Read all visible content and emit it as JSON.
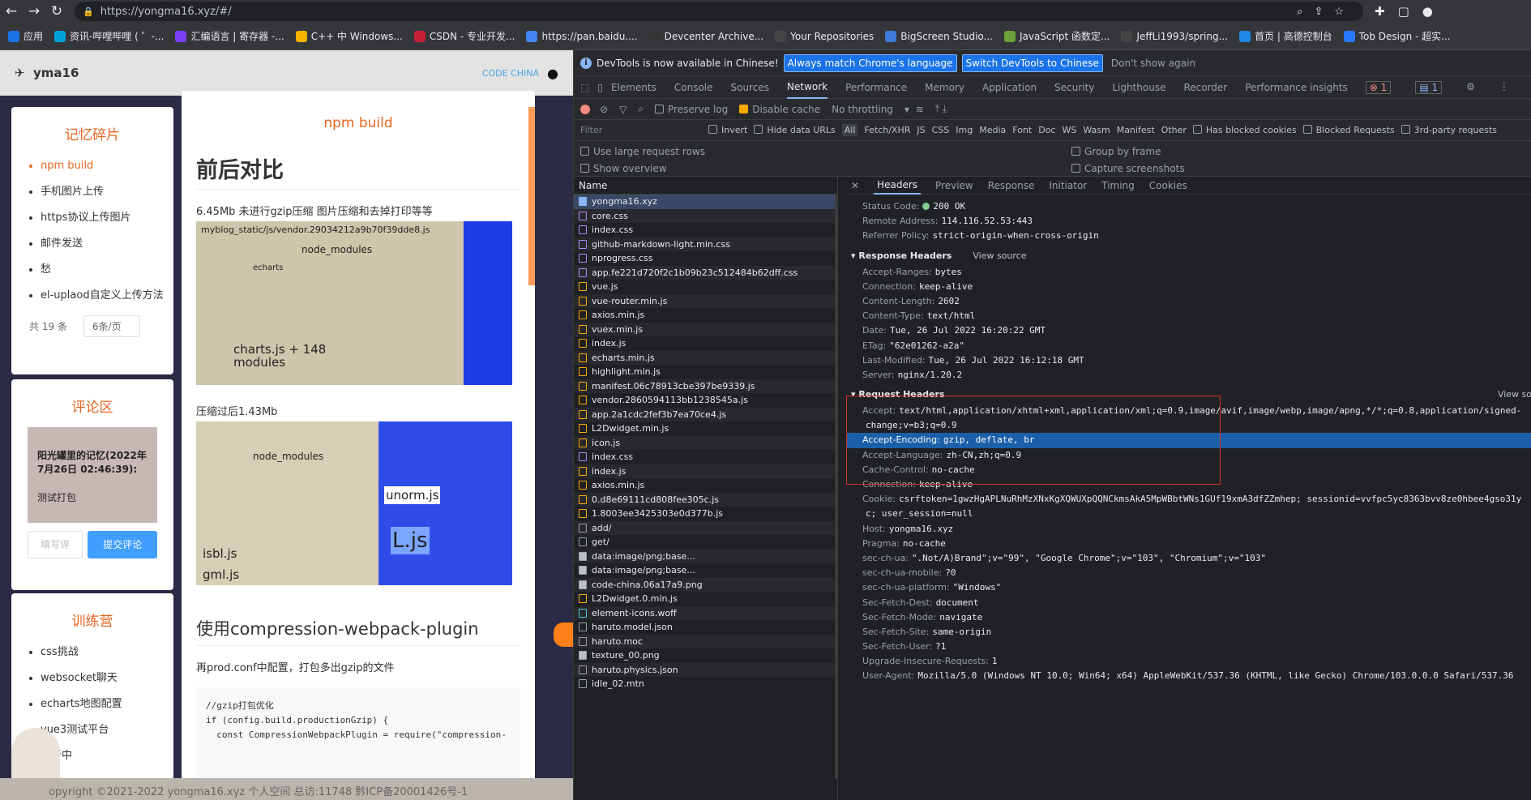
{
  "browser": {
    "url": "https://yongma16.xyz/#/"
  },
  "bookmarks": [
    "应用",
    "资讯-哔哩哔哩 ( ゜-...",
    "汇编语言 | 寄存器 -...",
    "C++ 中 Windows...",
    "CSDN - 专业开发...",
    "https://pan.baidu....",
    "Devcenter Archive...",
    "Your Repositories",
    "BigScreen Studio...",
    "JavaScript 函数定...",
    "JeffLi1993/spring...",
    "首页 | 高德控制台",
    "Tob Design - 超实..."
  ],
  "site": {
    "brand": "yma16",
    "logo_right": "CODE CHINA",
    "memory": {
      "title": "记忆碎片",
      "items": [
        "npm build",
        "手机图片上传",
        "https协议上传图片",
        "邮件发送",
        "愁",
        "el-uplaod自定义上传方法"
      ],
      "total": "共 19 条",
      "page_size": "6条/页"
    },
    "comments": {
      "title": "评论区",
      "entry_head": "阳光罐里的记忆(2022年7月26日 02:46:39):",
      "entry_text": "测试打包",
      "input_placeholder": "填写评",
      "submit": "提交评论"
    },
    "camp": {
      "title": "训练营",
      "items": [
        "css挑战",
        "websocket聊天",
        "echarts地图配置",
        "vue3测试平台",
        "更新中"
      ]
    },
    "article": {
      "title": "npm build",
      "h1": "前后对比",
      "p1": "6.45Mb 未进行gzip压缩 图片压缩和去掉打印等等",
      "tm1_top": "myblog_static/js/vendor.29034212a9b70f39dde8.js",
      "tm1_node": "node_modules",
      "tm1_echarts": "echarts",
      "tm1_charts": "charts.js + 148 modules",
      "p2": "压缩过后1.43Mb",
      "tm2_node": "node_modules",
      "tm2_unorm": "unorm.js",
      "tm2_ljs": "L.js",
      "tm2_isbl": "isbl.js",
      "tm2_gml": "gml.js",
      "h2": "使用compression-webpack-plugin",
      "p3": "再prod.conf中配置，打包多出gzip的文件",
      "code": "//gzip打包优化\nif (config.build.productionGzip) {\n  const CompressionWebpackPlugin = require(\"compression-"
    },
    "footer": "opyright ©2021-2022 yongma16.xyz 个人空间    总访:11748    黔ICP备20001426号-1"
  },
  "devtools": {
    "banner": {
      "text": "DevTools is now available in Chinese!",
      "btn1": "Always match Chrome's language",
      "btn2": "Switch DevTools to Chinese",
      "btn3": "Don't show again"
    },
    "tabs": [
      "Elements",
      "Console",
      "Sources",
      "Network",
      "Performance",
      "Memory",
      "Application",
      "Security",
      "Lighthouse",
      "Recorder",
      "Performance insights"
    ],
    "active_tab": "Network",
    "errors": "1",
    "messages": "1",
    "toolbar": {
      "preserve": "Preserve log",
      "disable_cache": "Disable cache",
      "throttle": "No throttling"
    },
    "filter": {
      "placeholder": "Filter",
      "items": [
        "Invert",
        "Hide data URLs",
        "All",
        "Fetch/XHR",
        "JS",
        "CSS",
        "Img",
        "Media",
        "Font",
        "Doc",
        "WS",
        "Wasm",
        "Manifest",
        "Other",
        "Has blocked cookies",
        "Blocked Requests",
        "3rd-party requests"
      ]
    },
    "options": {
      "large": "Use large request rows",
      "overview": "Show overview",
      "group": "Group by frame",
      "capture": "Capture screenshots"
    },
    "list_header": "Name",
    "requests": [
      {
        "name": "yongma16.xyz",
        "t": "doc"
      },
      {
        "name": "core.css",
        "t": "css"
      },
      {
        "name": "index.css",
        "t": "css"
      },
      {
        "name": "github-markdown-light.min.css",
        "t": "css"
      },
      {
        "name": "nprogress.css",
        "t": "css"
      },
      {
        "name": "app.fe221d720f2c1b09b23c512484b62dff.css",
        "t": "css"
      },
      {
        "name": "vue.js",
        "t": "js"
      },
      {
        "name": "vue-router.min.js",
        "t": "js"
      },
      {
        "name": "axios.min.js",
        "t": "js"
      },
      {
        "name": "vuex.min.js",
        "t": "js"
      },
      {
        "name": "index.js",
        "t": "js"
      },
      {
        "name": "echarts.min.js",
        "t": "js"
      },
      {
        "name": "highlight.min.js",
        "t": "js"
      },
      {
        "name": "manifest.06c78913cbe397be9339.js",
        "t": "js"
      },
      {
        "name": "vendor.2860594113bb1238545a.js",
        "t": "js"
      },
      {
        "name": "app.2a1cdc2fef3b7ea70ce4.js",
        "t": "js"
      },
      {
        "name": "L2Dwidget.min.js",
        "t": "js"
      },
      {
        "name": "icon.js",
        "t": "js"
      },
      {
        "name": "index.css",
        "t": "css"
      },
      {
        "name": "index.js",
        "t": "js"
      },
      {
        "name": "axios.min.js",
        "t": "js"
      },
      {
        "name": "0.d8e69111cd808fee305c.js",
        "t": "js"
      },
      {
        "name": "1.8003ee3425303e0d377b.js",
        "t": "js"
      },
      {
        "name": "add/",
        "t": "xhr"
      },
      {
        "name": "get/",
        "t": "xhr"
      },
      {
        "name": "data:image/png;base...",
        "t": "img"
      },
      {
        "name": "data:image/png;base...",
        "t": "img"
      },
      {
        "name": "code-china.06a17a9.png",
        "t": "img"
      },
      {
        "name": "L2Dwidget.0.min.js",
        "t": "js"
      },
      {
        "name": "element-icons.woff",
        "t": "font"
      },
      {
        "name": "haruto.model.json",
        "t": "xhr"
      },
      {
        "name": "haruto.moc",
        "t": "xhr"
      },
      {
        "name": "texture_00.png",
        "t": "img"
      },
      {
        "name": "haruto.physics.json",
        "t": "xhr"
      },
      {
        "name": "idle_02.mtn",
        "t": "xhr"
      }
    ],
    "detail_tabs": [
      "Headers",
      "Preview",
      "Response",
      "Initiator",
      "Timing",
      "Cookies"
    ],
    "general": [
      {
        "k": "Status Code:",
        "v": "200 OK"
      },
      {
        "k": "Remote Address:",
        "v": "114.116.52.53:443"
      },
      {
        "k": "Referrer Policy:",
        "v": "strict-origin-when-cross-origin"
      }
    ],
    "resp_title": "Response Headers",
    "view_source": "View source",
    "response_headers": [
      {
        "k": "Accept-Ranges:",
        "v": "bytes"
      },
      {
        "k": "Connection:",
        "v": "keep-alive"
      },
      {
        "k": "Content-Length:",
        "v": "2602"
      },
      {
        "k": "Content-Type:",
        "v": "text/html"
      },
      {
        "k": "Date:",
        "v": "Tue, 26 Jul 2022 16:20:22 GMT"
      },
      {
        "k": "ETag:",
        "v": "\"62e01262-a2a\""
      },
      {
        "k": "Last-Modified:",
        "v": "Tue, 26 Jul 2022 16:12:18 GMT"
      },
      {
        "k": "Server:",
        "v": "nginx/1.20.2"
      }
    ],
    "req_title": "Request Headers",
    "view_source2": "View so",
    "request_headers": [
      {
        "k": "Accept:",
        "v": "text/html,application/xhtml+xml,application/xml;q=0.9,image/avif,image/webp,image/apng,*/*;q=0.8,application/signed-"
      },
      {
        "k": "",
        "v": "change;v=b3;q=0.9"
      },
      {
        "k": "Accept-Encoding:",
        "v": "gzip, deflate, br"
      },
      {
        "k": "Accept-Language:",
        "v": "zh-CN,zh;q=0.9"
      },
      {
        "k": "Cache-Control:",
        "v": "no-cache"
      },
      {
        "k": "Connection:",
        "v": "keep-alive"
      },
      {
        "k": "Cookie:",
        "v": "csrftoken=1gwzHgAPLNuRhMzXNxKgXQWUXpQQNCkmsAkA5MpWBbtWNs1GUf19xmA3dfZZmhep; sessionid=vvfpc5yc8363bvv8ze0hbee4gso31y"
      },
      {
        "k": "",
        "v": "c; user_session=null"
      },
      {
        "k": "Host:",
        "v": "yongma16.xyz"
      },
      {
        "k": "Pragma:",
        "v": "no-cache"
      },
      {
        "k": "sec-ch-ua:",
        "v": "\".Not/A)Brand\";v=\"99\", \"Google Chrome\";v=\"103\", \"Chromium\";v=\"103\""
      },
      {
        "k": "sec-ch-ua-mobile:",
        "v": "?0"
      },
      {
        "k": "sec-ch-ua-platform:",
        "v": "\"Windows\""
      },
      {
        "k": "Sec-Fetch-Dest:",
        "v": "document"
      },
      {
        "k": "Sec-Fetch-Mode:",
        "v": "navigate"
      },
      {
        "k": "Sec-Fetch-Site:",
        "v": "same-origin"
      },
      {
        "k": "Sec-Fetch-User:",
        "v": "?1"
      },
      {
        "k": "Upgrade-Insecure-Requests:",
        "v": "1"
      },
      {
        "k": "User-Agent:",
        "v": "Mozilla/5.0 (Windows NT 10.0; Win64; x64) AppleWebKit/537.36 (KHTML, like Gecko) Chrome/103.0.0.0 Safari/537.36"
      }
    ]
  }
}
